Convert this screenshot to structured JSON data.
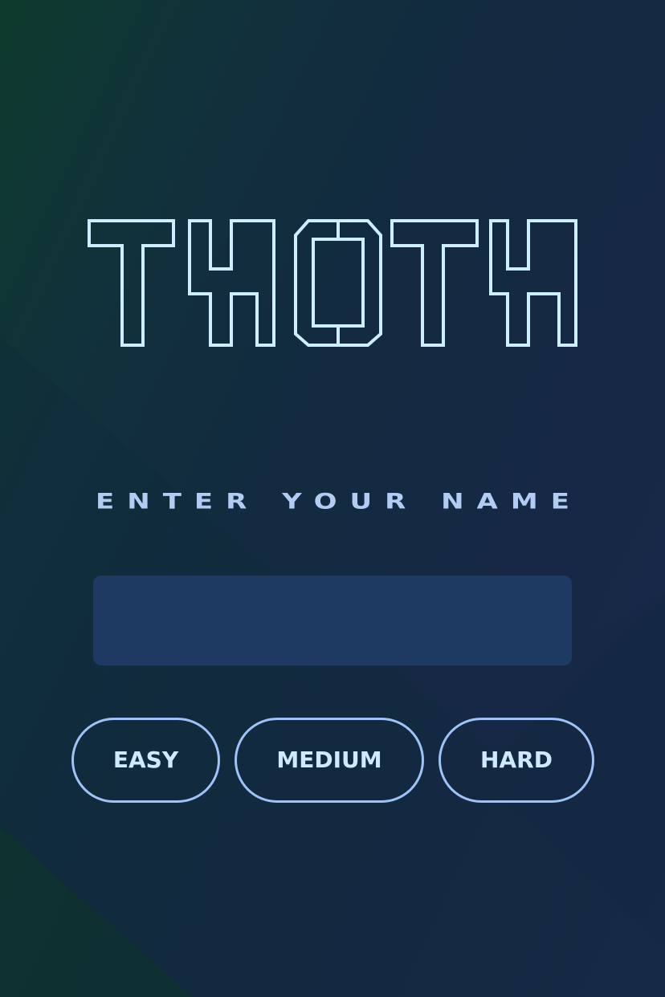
{
  "title": {
    "text": "THOTH"
  },
  "prompt": {
    "text": "ENTER YOUR NAME"
  },
  "name_input": {
    "value": "",
    "placeholder": ""
  },
  "difficulty": {
    "easy_label": "EASY",
    "medium_label": "MEDIUM",
    "hard_label": "HARD"
  },
  "colors": {
    "logo_outline": "#cdeeff",
    "prompt_text": "#b2ccf4",
    "input_fill": "#1f3a62",
    "button_border": "#9fc2f7",
    "button_text": "#cfeaff"
  }
}
